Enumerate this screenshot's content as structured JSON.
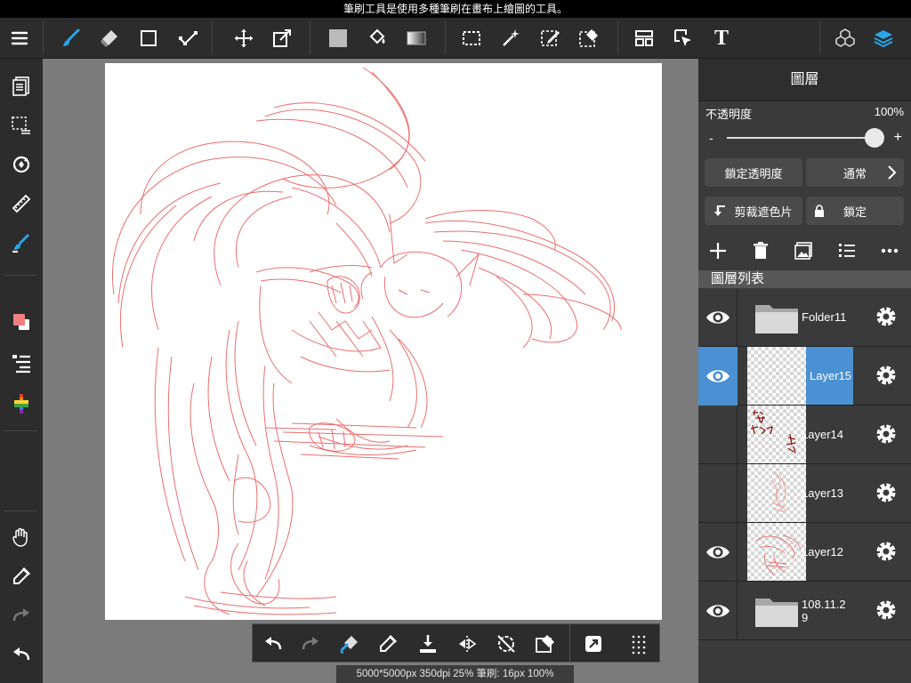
{
  "hint": "筆刷工具是使用多種筆刷在畫布上繪圖的工具。",
  "toolbar": {
    "items": [
      {
        "name": "menu-icon"
      },
      {
        "name": "brush-icon"
      },
      {
        "name": "eraser-icon"
      },
      {
        "name": "rectangle-icon"
      },
      {
        "name": "vector-icon"
      },
      {
        "name": "move-icon"
      },
      {
        "name": "transform-icon"
      },
      {
        "name": "fill-color-icon"
      },
      {
        "name": "bucket-icon"
      },
      {
        "name": "gradient-icon"
      },
      {
        "name": "select-rect-icon"
      },
      {
        "name": "magic-wand-icon"
      },
      {
        "name": "select-pen-icon"
      },
      {
        "name": "select-eraser-icon"
      },
      {
        "name": "frame-icon"
      },
      {
        "name": "operation-icon"
      },
      {
        "name": "text-icon"
      },
      {
        "name": "material-icon"
      },
      {
        "name": "layers-icon"
      }
    ],
    "text_tool_glyph": "T",
    "accent": "#2aa6e8"
  },
  "left_bar": {
    "items": [
      "pages-icon",
      "selection-list-icon",
      "rotate-view-icon",
      "ruler-icon",
      "brush-settings-icon",
      "color-swatch-icon",
      "layer-props-icon",
      "color-palette-icon",
      "hand-icon",
      "eyedropper-icon",
      "redo-icon",
      "undo-icon"
    ],
    "primary_color": "#f07f7f",
    "secondary_color": "#ffffff"
  },
  "bottom_bar": {
    "items": [
      "undo-icon",
      "redo-icon",
      "brush-eraser-icon",
      "eyedropper-icon",
      "import-icon",
      "flip-icon",
      "rotate-off-icon",
      "clear-icon",
      "external-icon",
      "grid-dots-icon"
    ]
  },
  "status_text": "5000*5000px 350dpi 25% 筆刷: 16px 100%",
  "panel": {
    "title": "圖層",
    "opacity_label": "不透明度",
    "opacity_value": "100%",
    "slider_minus": "-",
    "slider_plus": "+",
    "lock_alpha_label": "鎖定透明度",
    "blend_mode_label": "通常",
    "clipping_label": "剪裁遮色片",
    "lock_label": "鎖定",
    "list_header": "圖層列表",
    "layers": [
      {
        "name": "Folder11",
        "visible": true,
        "selected": false,
        "kind": "folder"
      },
      {
        "name": "Layer15",
        "visible": true,
        "selected": true,
        "kind": "empty"
      },
      {
        "name": "Layer14",
        "visible": false,
        "selected": false,
        "kind": "notes"
      },
      {
        "name": "Layer13",
        "visible": false,
        "selected": false,
        "kind": "sketch-light"
      },
      {
        "name": "Layer12",
        "visible": true,
        "selected": false,
        "kind": "sketch"
      },
      {
        "name": "108.11.29",
        "visible": true,
        "selected": false,
        "kind": "folder"
      }
    ]
  },
  "colors": {
    "accent_blue": "#4a90d2",
    "sketch_red": "#e85555",
    "panel_bg": "#3a3a3a",
    "toolbar_bg": "#2c2c2c",
    "canvas_bg": "#7b7b7b"
  }
}
